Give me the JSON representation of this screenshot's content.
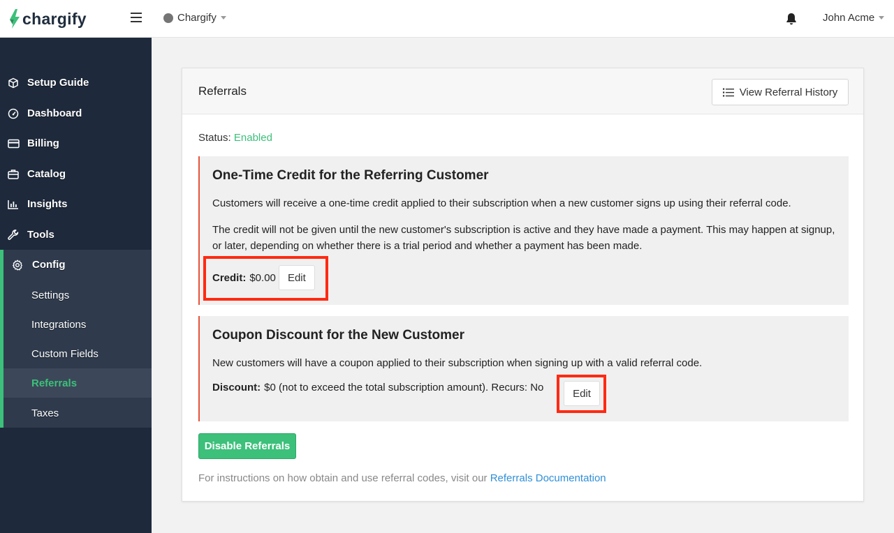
{
  "brand": {
    "name": "chargify",
    "accent": "#3cc07a"
  },
  "topbar": {
    "site_name": "Chargify",
    "user_name": "John Acme"
  },
  "sidebar": {
    "items": [
      {
        "label": "Setup Guide",
        "icon": "cube-icon"
      },
      {
        "label": "Dashboard",
        "icon": "gauge-icon"
      },
      {
        "label": "Billing",
        "icon": "credit-card-icon"
      },
      {
        "label": "Catalog",
        "icon": "briefcase-icon"
      },
      {
        "label": "Insights",
        "icon": "bar-chart-icon"
      },
      {
        "label": "Tools",
        "icon": "wrench-icon"
      },
      {
        "label": "Config",
        "icon": "gear-icon"
      }
    ],
    "config_items": [
      {
        "label": "Settings"
      },
      {
        "label": "Integrations"
      },
      {
        "label": "Custom Fields"
      },
      {
        "label": "Referrals",
        "active": true
      },
      {
        "label": "Taxes"
      }
    ]
  },
  "card": {
    "title": "Referrals",
    "history_button": "View Referral History",
    "status_label": "Status:",
    "status_value": "Enabled",
    "credit_panel": {
      "title": "One-Time Credit for the Referring Customer",
      "para1": "Customers will receive a one-time credit applied to their subscription when a new customer signs up using their referral code.",
      "para2": "The credit will not be given until the new customer's subscription is active and they have made a payment. This may happen at signup, or later, depending on whether there is a trial period and whether a payment has been made.",
      "field_label": "Credit:",
      "field_value": "$0.00",
      "edit_label": "Edit"
    },
    "coupon_panel": {
      "title": "Coupon Discount for the New Customer",
      "para1": "New customers will have a coupon applied to their subscription when signing up with a valid referral code.",
      "field_label": "Discount:",
      "field_value": "$0 (not to exceed the total subscription amount). Recurs: No",
      "edit_label": "Edit"
    },
    "disable_button": "Disable Referrals",
    "footnote_text": "For instructions on how obtain and use referral codes, visit our",
    "footnote_link": "Referrals Documentation"
  }
}
